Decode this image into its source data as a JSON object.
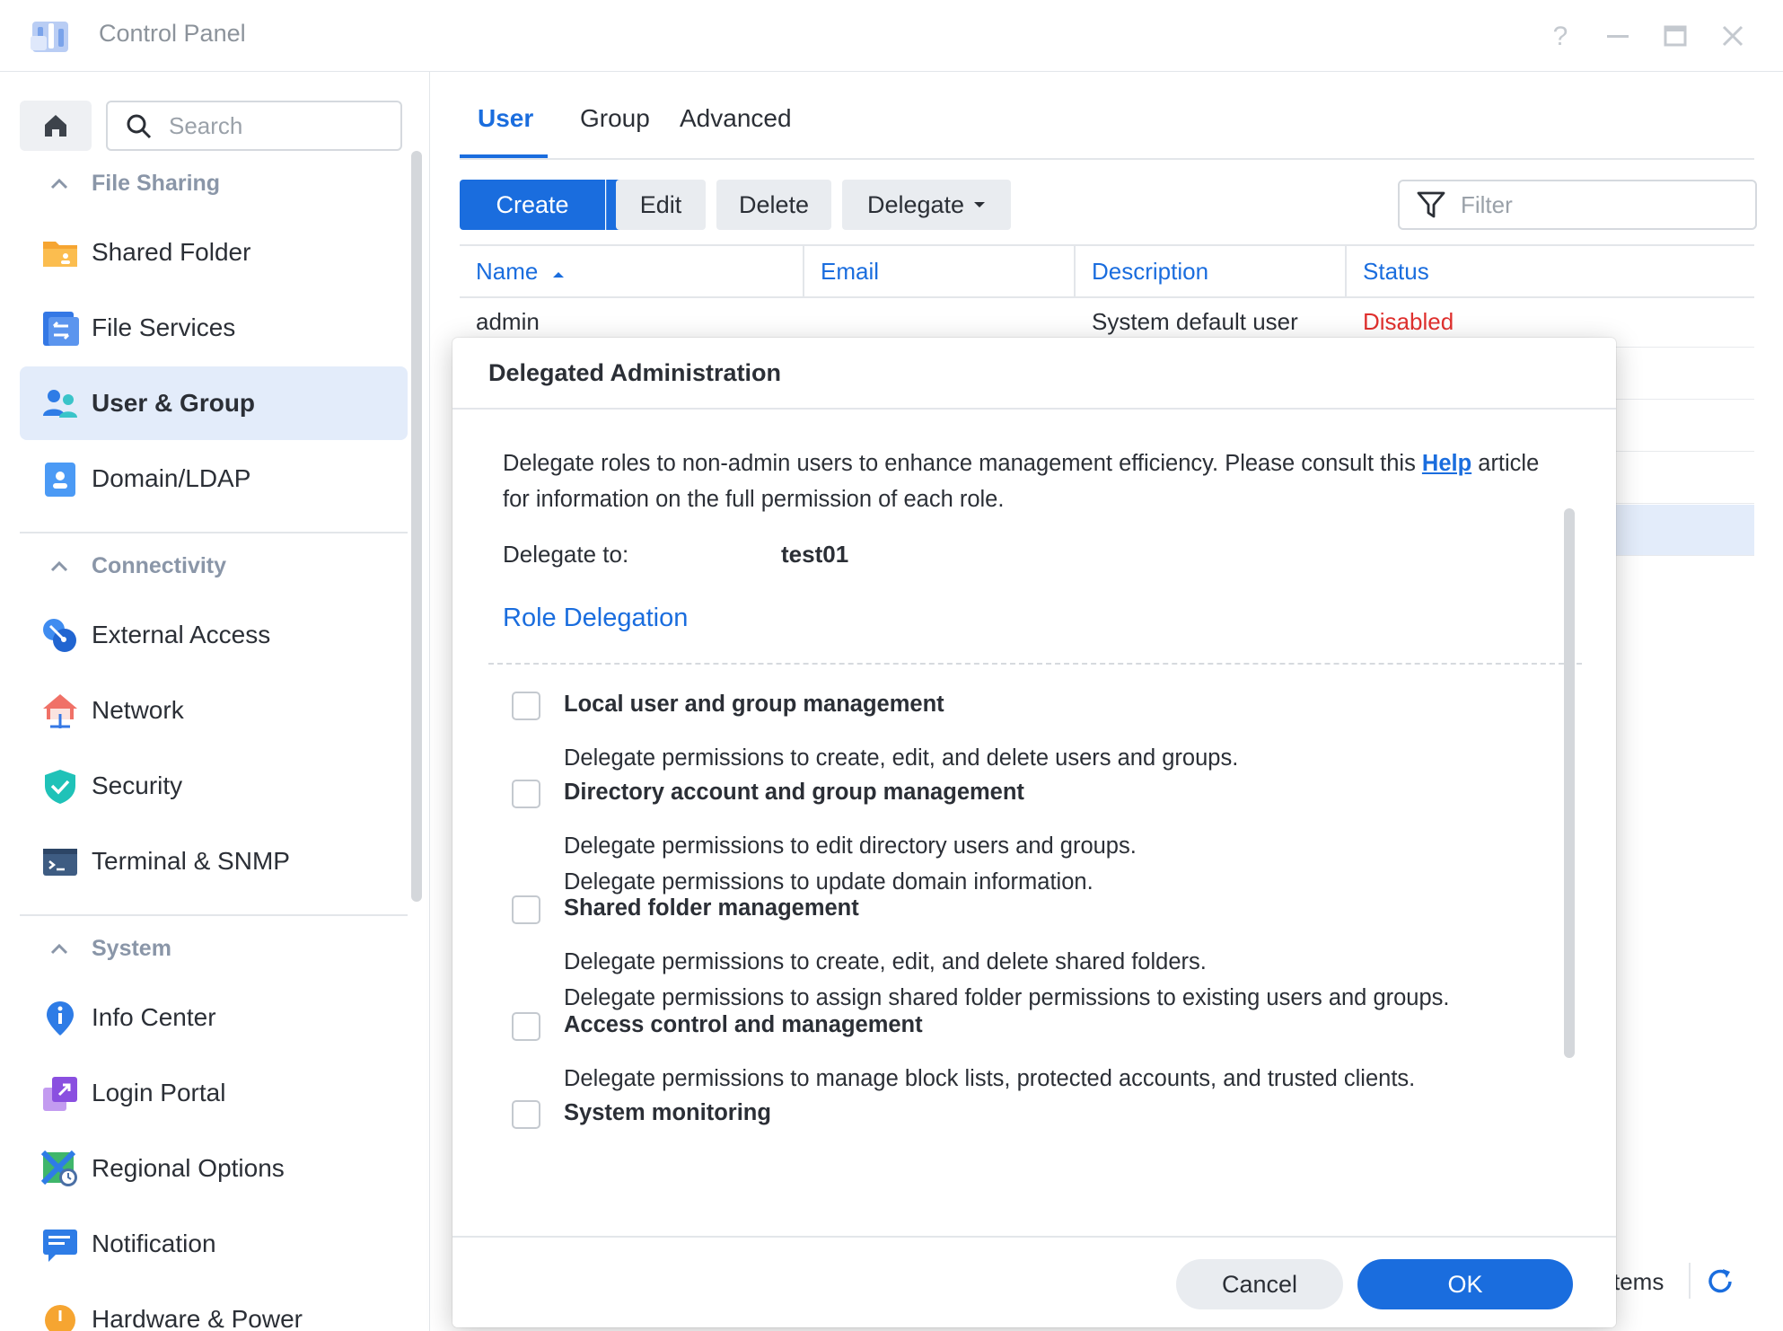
{
  "window": {
    "title": "Control Panel",
    "controls": [
      "help-icon",
      "minimize-icon",
      "maximize-icon",
      "close-icon"
    ]
  },
  "sidebar": {
    "search_placeholder": "Search",
    "sections": [
      {
        "title": "File Sharing",
        "items": [
          {
            "label": "Shared Folder",
            "icon": "shared-folder-icon"
          },
          {
            "label": "File Services",
            "icon": "file-services-icon"
          },
          {
            "label": "User & Group",
            "icon": "user-group-icon",
            "active": true
          },
          {
            "label": "Domain/LDAP",
            "icon": "domain-ldap-icon"
          }
        ]
      },
      {
        "title": "Connectivity",
        "items": [
          {
            "label": "External Access",
            "icon": "external-access-icon"
          },
          {
            "label": "Network",
            "icon": "network-icon"
          },
          {
            "label": "Security",
            "icon": "security-shield-icon"
          },
          {
            "label": "Terminal & SNMP",
            "icon": "terminal-icon"
          }
        ]
      },
      {
        "title": "System",
        "items": [
          {
            "label": "Info Center",
            "icon": "info-center-icon"
          },
          {
            "label": "Login Portal",
            "icon": "login-portal-icon"
          },
          {
            "label": "Regional Options",
            "icon": "regional-options-icon"
          },
          {
            "label": "Notification",
            "icon": "notification-icon"
          },
          {
            "label": "Hardware & Power",
            "icon": "hardware-power-icon"
          }
        ]
      }
    ]
  },
  "main": {
    "tabs": [
      "User",
      "Group",
      "Advanced"
    ],
    "active_tab": "User",
    "toolbar": {
      "create": "Create",
      "edit": "Edit",
      "delete": "Delete",
      "delegate": "Delegate",
      "filter_placeholder": "Filter"
    },
    "table": {
      "columns": [
        "Name",
        "Email",
        "Description",
        "Status"
      ],
      "sort_column": "Name",
      "rows": [
        {
          "name": "admin",
          "email": "",
          "description": "System default user",
          "status": "Disabled"
        }
      ]
    },
    "footer_items_text": "tems"
  },
  "dialog": {
    "title": "Delegated Administration",
    "intro_before_link": "Delegate roles to non-admin users to enhance management efficiency. Please consult this ",
    "help_link": "Help",
    "intro_after_link": " article for information on the full permission of each role.",
    "delegate_to_label": "Delegate to:",
    "delegate_to_value": "test01",
    "section_title": "Role Delegation",
    "roles": [
      {
        "name": "Local user and group management",
        "checked": false,
        "desc": [
          "Delegate permissions to create, edit, and delete users and groups."
        ]
      },
      {
        "name": "Directory account and group management",
        "checked": false,
        "desc": [
          "Delegate permissions to edit directory users and groups.",
          "Delegate permissions to update domain information."
        ]
      },
      {
        "name": "Shared folder management",
        "checked": false,
        "desc": [
          "Delegate permissions to create, edit, and delete shared folders.",
          "Delegate permissions to assign shared folder permissions to existing users and groups."
        ]
      },
      {
        "name": "Access control and management",
        "checked": false,
        "desc": [
          "Delegate permissions to manage block lists, protected accounts, and trusted clients."
        ]
      },
      {
        "name": "System monitoring",
        "checked": false,
        "desc": []
      }
    ],
    "cancel": "Cancel",
    "ok": "OK"
  },
  "colors": {
    "accent": "#1a6dde",
    "active_bg": "#e3ecfa",
    "disabled_status": "#e0302e",
    "section_header": "#8a96a8"
  }
}
